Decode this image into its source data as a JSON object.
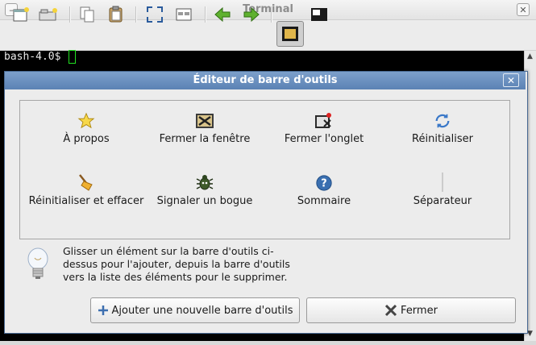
{
  "window": {
    "title": "Terminal"
  },
  "terminal": {
    "prompt": "bash-4.0$"
  },
  "dialog": {
    "title": "Éditeur de barre d'outils",
    "items": [
      {
        "label": "À propos",
        "icon": "star-icon"
      },
      {
        "label": "Fermer la fenêtre",
        "icon": "close-window-icon"
      },
      {
        "label": "Fermer l'onglet",
        "icon": "close-tab-icon"
      },
      {
        "label": "Réinitialiser",
        "icon": "refresh-icon"
      },
      {
        "label": "Réinitialiser et effacer",
        "icon": "broom-icon"
      },
      {
        "label": "Signaler un bogue",
        "icon": "bug-icon"
      },
      {
        "label": "Sommaire",
        "icon": "help-icon"
      },
      {
        "label": "Séparateur",
        "icon": "separator-icon"
      }
    ],
    "hint": "Glisser un élément sur la barre d'outils ci-dessus pour l'ajouter, depuis la barre d'outils vers la liste des éléments pour le supprimer.",
    "add_button": "Ajouter une nouvelle barre d'outils",
    "close_button": "Fermer"
  },
  "colors": {
    "dialog_title": "#6a8fbf",
    "terminal_bg": "#000000",
    "cursor": "#22e022"
  }
}
